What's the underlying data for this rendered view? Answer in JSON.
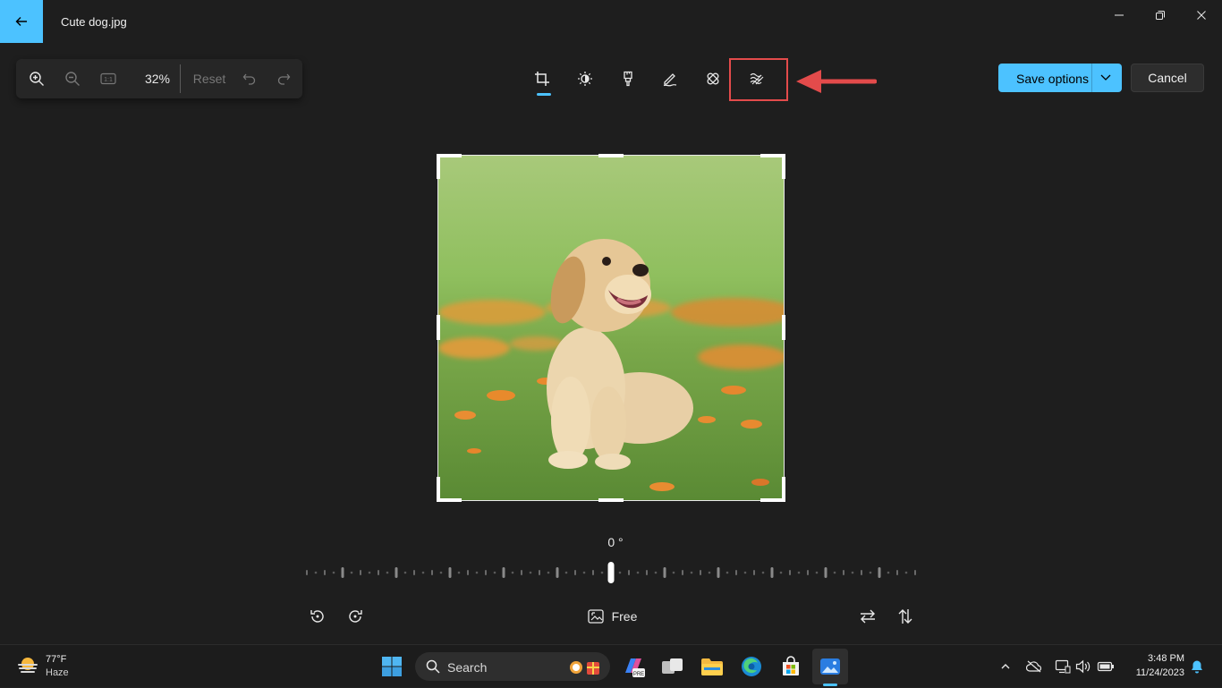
{
  "window": {
    "title": "Cute dog.jpg"
  },
  "zoom_toolbar": {
    "zoom_level": "32%",
    "reset_label": "Reset"
  },
  "tools": {
    "items": [
      "crop-icon",
      "adjustment-icon",
      "filter-icon",
      "markup-icon",
      "retouch-icon",
      "background-blur-icon"
    ],
    "active": "crop-icon",
    "highlighted": "background-blur-icon"
  },
  "actions": {
    "save_label": "Save options",
    "cancel_label": "Cancel"
  },
  "photo": {
    "subject": "puppy"
  },
  "rotation": {
    "angle_label": "0 °",
    "aspect_label": "Free"
  },
  "taskbar": {
    "weather_temp": "77°F",
    "weather_condition": "Haze",
    "search_label": "Search",
    "time": "3:48 PM",
    "date": "11/24/2023"
  },
  "colors": {
    "accent": "#4cc2ff",
    "highlight": "#e34b4b",
    "background": "#1e1e1e"
  }
}
